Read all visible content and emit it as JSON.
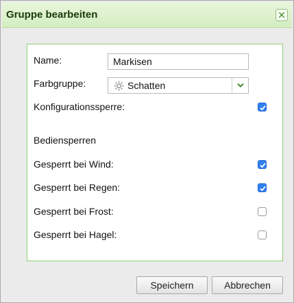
{
  "dialog": {
    "title": "Gruppe bearbeiten",
    "close_symbol": "✕"
  },
  "form": {
    "name_label": "Name:",
    "name_value": "Markisen",
    "farbgruppe_label": "Farbgruppe:",
    "farbgruppe_value": "Schatten",
    "farbgruppe_icon": "gear-icon",
    "konfigurationssperre_label": "Konfigurationssperre:",
    "konfigurationssperre_checked": true,
    "section_heading": "Bediensperren",
    "locks": [
      {
        "label": "Gesperrt bei Wind:",
        "checked": true
      },
      {
        "label": "Gesperrt bei Regen:",
        "checked": true
      },
      {
        "label": "Gesperrt bei Frost:",
        "checked": false
      },
      {
        "label": "Gesperrt bei Hagel:",
        "checked": false
      }
    ]
  },
  "buttons": {
    "save_label": "Speichern",
    "cancel_label": "Abbrechen"
  },
  "colors": {
    "accent_green": "#8fcf73",
    "checkbox_blue": "#2f7ff0"
  }
}
